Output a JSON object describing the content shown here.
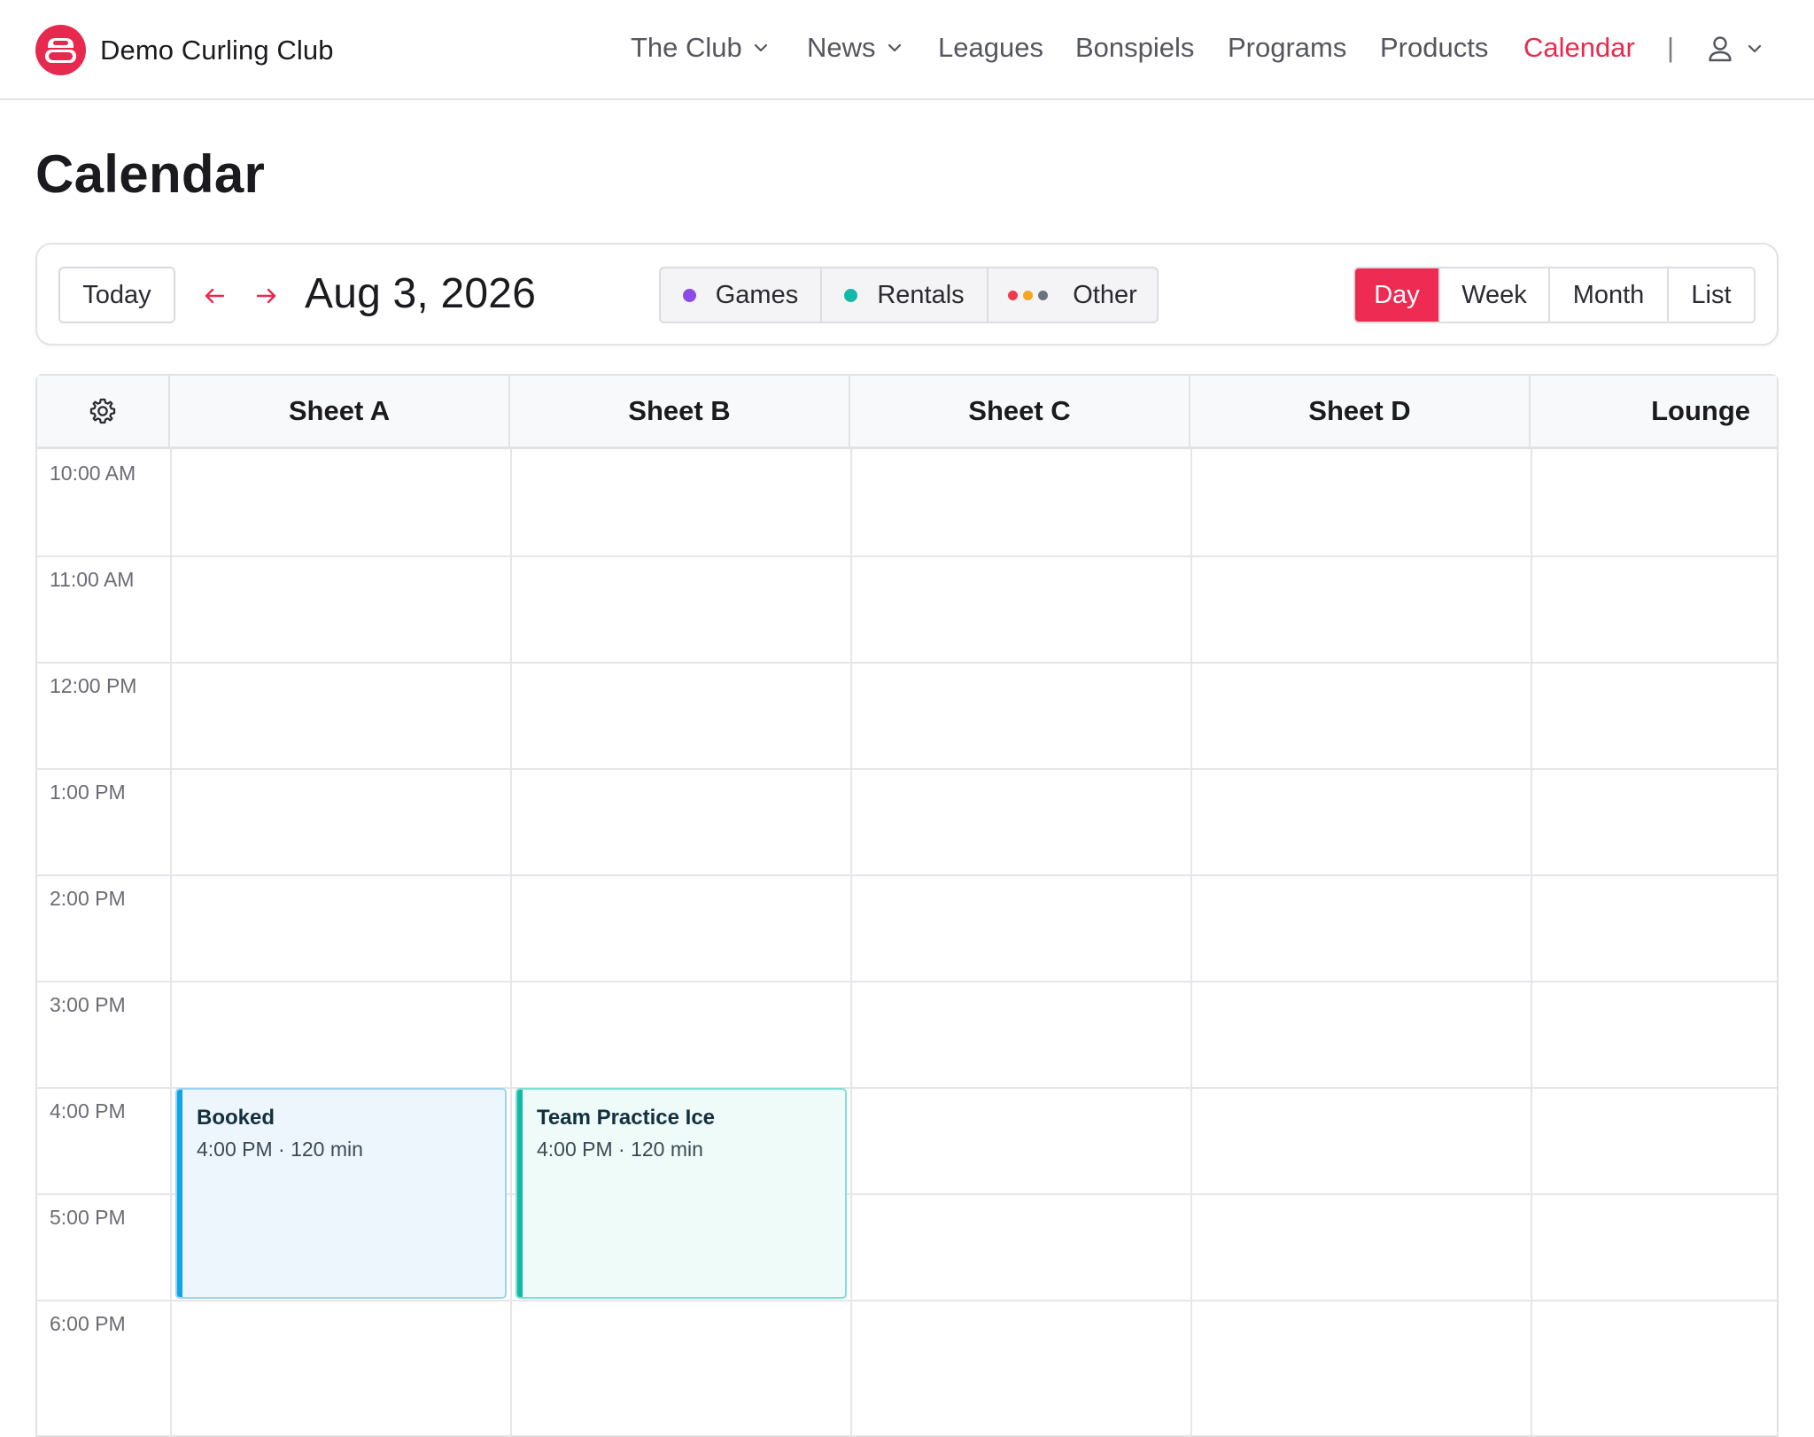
{
  "brand": {
    "name": "Demo Curling Club",
    "accent": "#e8294f"
  },
  "nav": {
    "items": [
      {
        "label": "The Club",
        "dropdown": true
      },
      {
        "label": "News",
        "dropdown": true
      },
      {
        "label": "Leagues"
      },
      {
        "label": "Bonspiels"
      },
      {
        "label": "Programs"
      },
      {
        "label": "Products"
      },
      {
        "label": "Calendar",
        "active": true
      }
    ],
    "separator": "|",
    "user_icon": "user-icon"
  },
  "page": {
    "title": "Calendar"
  },
  "toolbar": {
    "today_label": "Today",
    "prev_icon": "arrow-left-icon",
    "next_icon": "arrow-right-icon",
    "date": "Aug 3, 2026",
    "filters": [
      {
        "label": "Games",
        "color": "#8b4be8"
      },
      {
        "label": "Rentals",
        "color": "#14b8a6"
      },
      {
        "label": "Other",
        "colors": [
          "#f0394f",
          "#f5a623",
          "#6b7280"
        ]
      }
    ],
    "views": [
      {
        "label": "Day",
        "active": true
      },
      {
        "label": "Week"
      },
      {
        "label": "Month"
      },
      {
        "label": "List"
      }
    ]
  },
  "calendar": {
    "settings_icon": "gear-icon",
    "columns": [
      "Sheet A",
      "Sheet B",
      "Sheet C",
      "Sheet D",
      "Lounge"
    ],
    "times": [
      "10:00 AM",
      "11:00 AM",
      "12:00 PM",
      "1:00 PM",
      "2:00 PM",
      "3:00 PM",
      "4:00 PM",
      "5:00 PM",
      "6:00 PM"
    ],
    "events": [
      {
        "title": "Booked",
        "meta": "4:00 PM · 120 min",
        "column": "Sheet A",
        "start": "4:00 PM",
        "duration_min": 120,
        "accent": "#0ea5e9",
        "background": "#eef6fd",
        "border": "#9ed3f0"
      },
      {
        "title": "Team Practice Ice",
        "meta": "4:00 PM · 120 min",
        "column": "Sheet B",
        "start": "4:00 PM",
        "duration_min": 120,
        "accent": "#14b8a6",
        "background": "#eefbf8",
        "border": "#7ee0d2"
      }
    ]
  }
}
